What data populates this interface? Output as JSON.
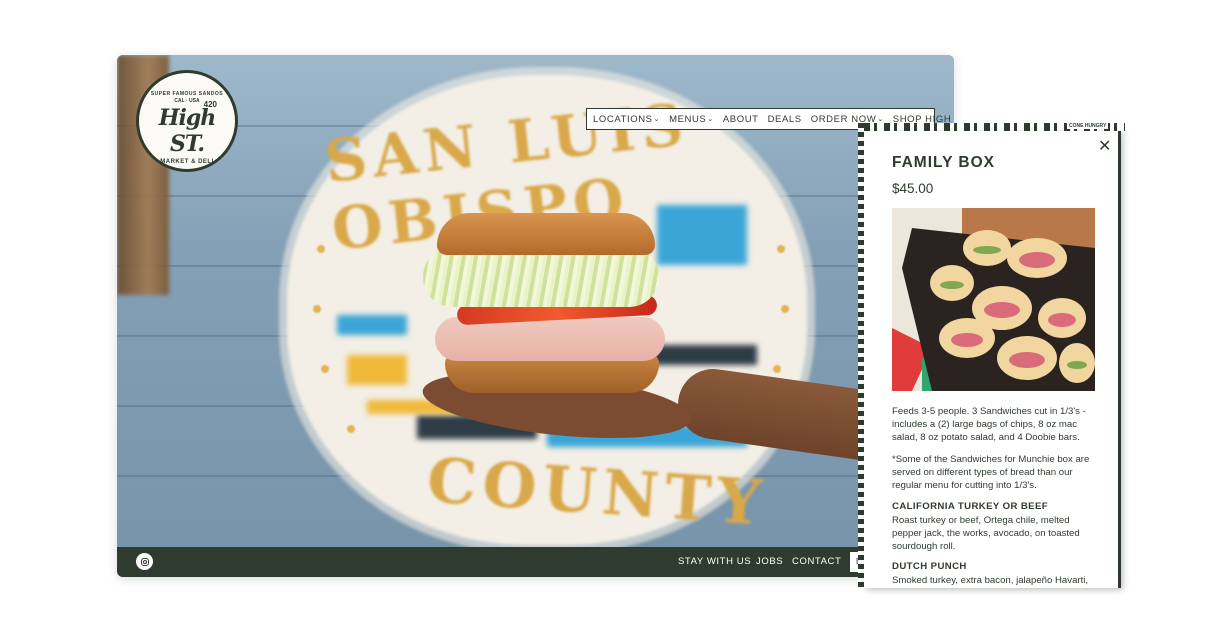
{
  "logo": {
    "tagline_top": "SUPER FAMOUS SANDOS",
    "tagline_mid": "CAL · USA",
    "number": "420",
    "name": "High ST.",
    "sub": "MARKET & DELI"
  },
  "hero": {
    "sign_top": "SAN LUIS OBISPO",
    "sign_bottom": "COUNTY"
  },
  "nav": {
    "items": [
      {
        "label": "LOCATIONS",
        "has_dropdown": true
      },
      {
        "label": "MENUS",
        "has_dropdown": true
      },
      {
        "label": "ABOUT",
        "has_dropdown": false
      },
      {
        "label": "DEALS",
        "has_dropdown": false
      },
      {
        "label": "ORDER NOW",
        "has_dropdown": true
      },
      {
        "label": "SHOP HIGH",
        "has_dropdown": false
      }
    ]
  },
  "footer": {
    "links": [
      "STAY WITH US",
      "JOBS",
      "CONTACT"
    ],
    "box_label": "E"
  },
  "modal": {
    "strip_label": "CONE HUNGRY",
    "title": "FAMILY BOX",
    "price": "$45.00",
    "description": "Feeds 3-5 people. 3 Sandwiches cut in 1/3's - includes a (2) large bags of chips, 8 oz mac salad, 8 oz potato salad, and 4 Doobie bars.",
    "note": "*Some of the Sandwiches for Munchie box are served on different types of bread than our regular menu for cutting into 1/3's.",
    "items": [
      {
        "name": "CALIFORNIA TURKEY OR BEEF",
        "desc": "Roast turkey or beef, Ortega chile, melted pepper jack, the works, avocado, on toasted sourdough roll."
      },
      {
        "name": "DUTCH PUNCH",
        "desc": "Smoked turkey, extra bacon, jalapeño Havarti,"
      }
    ]
  },
  "colors": {
    "brand_green": "#2f3b2f",
    "white": "#ffffff"
  },
  "icons": {
    "close": "close-icon",
    "instagram": "instagram-icon",
    "chevron": "chevron-down-icon"
  }
}
